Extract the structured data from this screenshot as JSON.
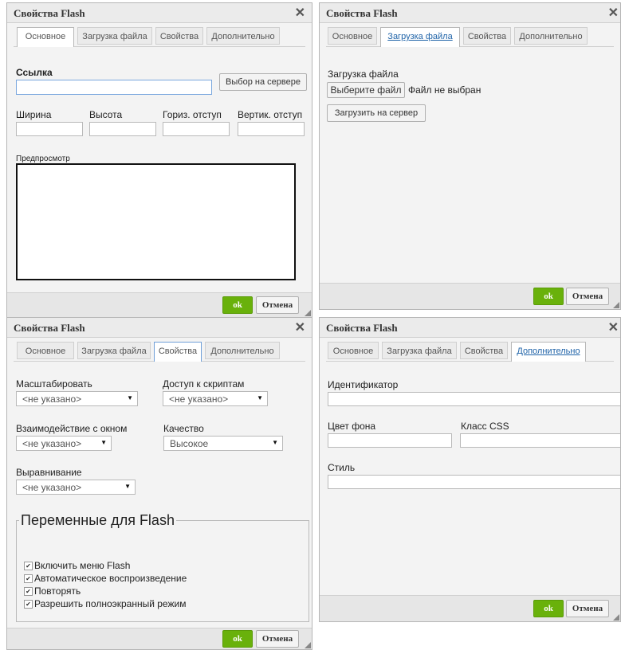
{
  "dialogs": {
    "basic": {
      "title": "Свойства Flash",
      "tabs": [
        "Основное",
        "Загрузка файла",
        "Свойства",
        "Дополнительно"
      ],
      "url_label": "Ссылка",
      "url_value": "",
      "browse_button": "Выбор на сервере",
      "width_label": "Ширина",
      "height_label": "Высота",
      "hspace_label": "Гориз. отступ",
      "vspace_label": "Вертик. отступ",
      "preview_label": "Предпросмотр",
      "ok": "ok",
      "cancel": "Отмена"
    },
    "upload": {
      "title": "Свойства Flash",
      "tabs": [
        "Основное",
        "Загрузка файла",
        "Свойства",
        "Дополнительно"
      ],
      "section_label": "Загрузка файла",
      "choose_button": "Выберите файл",
      "no_file_text": "Файл не выбран",
      "upload_button": "Загрузить на сервер",
      "ok": "ok",
      "cancel": "Отмена"
    },
    "properties": {
      "title": "Свойства Flash",
      "tabs": [
        "Основное",
        "Загрузка файла",
        "Свойства",
        "Дополнительно"
      ],
      "scale_label": "Масштабировать",
      "scale_value": "<не указано>",
      "script_access_label": "Доступ к скриптам",
      "script_access_value": "<не указано>",
      "window_mode_label": "Взаимодействие с окном",
      "window_mode_value": "<не указано>",
      "quality_label": "Качество",
      "quality_value": "Высокое",
      "align_label": "Выравнивание",
      "align_value": "<не указано>",
      "flash_vars_legend": "Переменные для Flash",
      "checkboxes": [
        "Включить меню Flash",
        "Автоматическое воспроизведение",
        "Повторять",
        "Разрешить полноэкранный режим"
      ],
      "ok": "ok",
      "cancel": "Отмена"
    },
    "advanced": {
      "title": "Свойства Flash",
      "tabs": [
        "Основное",
        "Загрузка файла",
        "Свойства",
        "Дополнительно"
      ],
      "id_label": "Идентификатор",
      "bgcolor_label": "Цвет фона",
      "class_label": "Класс CSS",
      "style_label": "Стиль",
      "ok": "ok",
      "cancel": "Отмена"
    }
  },
  "icons": {
    "close": "close-icon",
    "resize": "resize-grip-icon",
    "check": "checkmark-icon"
  },
  "colors": {
    "ok_green": "#69b10b",
    "link_blue": "#1f63a8"
  }
}
